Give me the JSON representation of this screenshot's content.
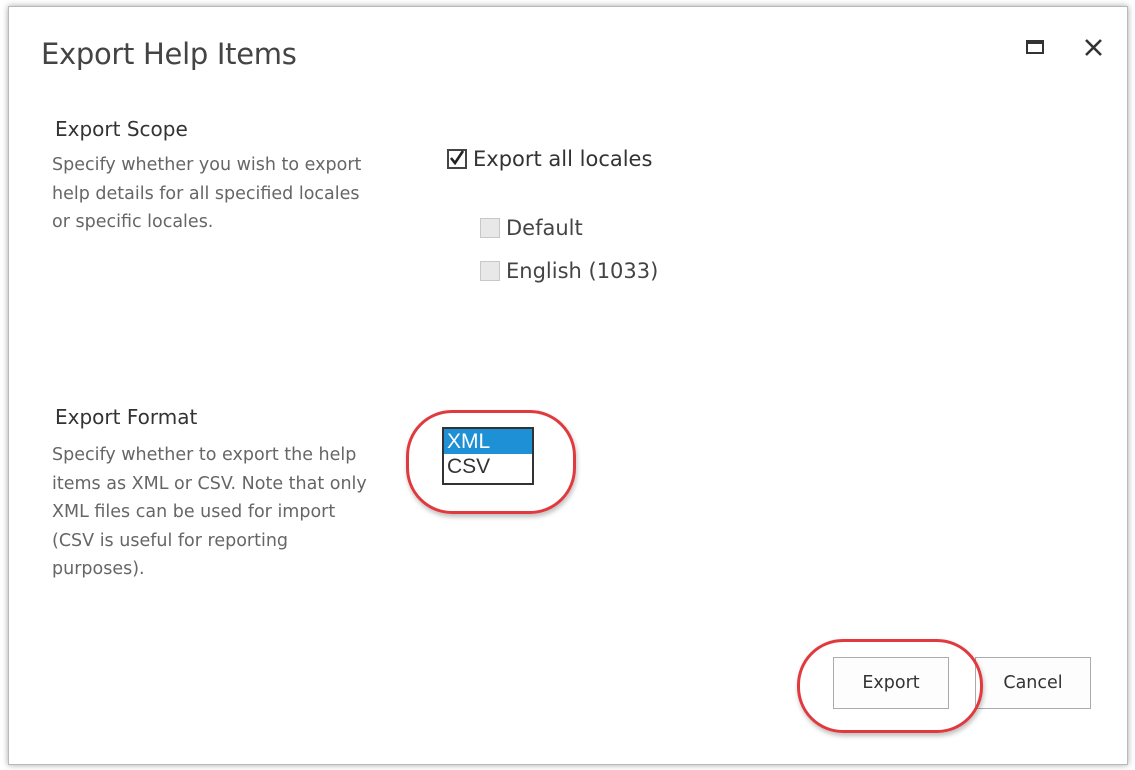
{
  "dialog": {
    "title": "Export Help Items",
    "maximize_icon": "maximize-icon",
    "close_icon": "close-icon"
  },
  "export_scope": {
    "heading": "Export Scope",
    "description": "Specify whether you wish to export help details for all specified locales or specific locales.",
    "all_locales": {
      "label": "Export all locales",
      "checked": true
    },
    "locales": [
      {
        "label": "Default",
        "checked": false,
        "disabled": true
      },
      {
        "label": "English (1033)",
        "checked": false,
        "disabled": true
      }
    ]
  },
  "export_format": {
    "heading": "Export Format",
    "description": "Specify whether to export the help items as XML or CSV. Note that only XML files can be used for import (CSV is useful for reporting purposes).",
    "options": [
      "XML",
      "CSV"
    ],
    "selected": "XML"
  },
  "buttons": {
    "export_label": "Export",
    "cancel_label": "Cancel"
  },
  "colors": {
    "selected_option": "#1e90d6",
    "annotation_highlight": "#e0393e"
  }
}
